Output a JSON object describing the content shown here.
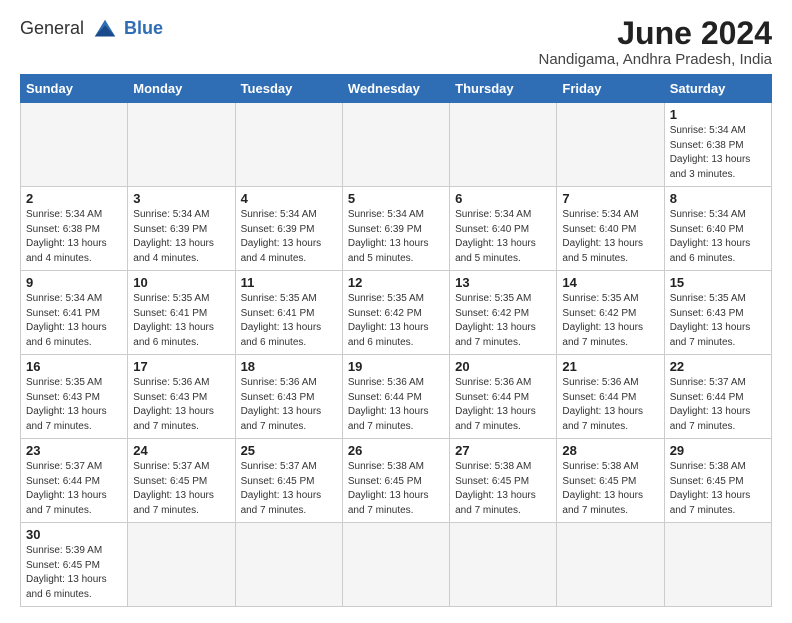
{
  "header": {
    "logo_general": "General",
    "logo_blue": "Blue",
    "title": "June 2024",
    "subtitle": "Nandigama, Andhra Pradesh, India"
  },
  "days_of_week": [
    "Sunday",
    "Monday",
    "Tuesday",
    "Wednesday",
    "Thursday",
    "Friday",
    "Saturday"
  ],
  "weeks": [
    [
      {
        "day": "",
        "info": ""
      },
      {
        "day": "",
        "info": ""
      },
      {
        "day": "",
        "info": ""
      },
      {
        "day": "",
        "info": ""
      },
      {
        "day": "",
        "info": ""
      },
      {
        "day": "",
        "info": ""
      },
      {
        "day": "1",
        "info": "Sunrise: 5:34 AM\nSunset: 6:38 PM\nDaylight: 13 hours\nand 3 minutes."
      }
    ],
    [
      {
        "day": "2",
        "info": "Sunrise: 5:34 AM\nSunset: 6:38 PM\nDaylight: 13 hours\nand 4 minutes."
      },
      {
        "day": "3",
        "info": "Sunrise: 5:34 AM\nSunset: 6:39 PM\nDaylight: 13 hours\nand 4 minutes."
      },
      {
        "day": "4",
        "info": "Sunrise: 5:34 AM\nSunset: 6:39 PM\nDaylight: 13 hours\nand 4 minutes."
      },
      {
        "day": "5",
        "info": "Sunrise: 5:34 AM\nSunset: 6:39 PM\nDaylight: 13 hours\nand 5 minutes."
      },
      {
        "day": "6",
        "info": "Sunrise: 5:34 AM\nSunset: 6:40 PM\nDaylight: 13 hours\nand 5 minutes."
      },
      {
        "day": "7",
        "info": "Sunrise: 5:34 AM\nSunset: 6:40 PM\nDaylight: 13 hours\nand 5 minutes."
      },
      {
        "day": "8",
        "info": "Sunrise: 5:34 AM\nSunset: 6:40 PM\nDaylight: 13 hours\nand 6 minutes."
      }
    ],
    [
      {
        "day": "9",
        "info": "Sunrise: 5:34 AM\nSunset: 6:41 PM\nDaylight: 13 hours\nand 6 minutes."
      },
      {
        "day": "10",
        "info": "Sunrise: 5:35 AM\nSunset: 6:41 PM\nDaylight: 13 hours\nand 6 minutes."
      },
      {
        "day": "11",
        "info": "Sunrise: 5:35 AM\nSunset: 6:41 PM\nDaylight: 13 hours\nand 6 minutes."
      },
      {
        "day": "12",
        "info": "Sunrise: 5:35 AM\nSunset: 6:42 PM\nDaylight: 13 hours\nand 6 minutes."
      },
      {
        "day": "13",
        "info": "Sunrise: 5:35 AM\nSunset: 6:42 PM\nDaylight: 13 hours\nand 7 minutes."
      },
      {
        "day": "14",
        "info": "Sunrise: 5:35 AM\nSunset: 6:42 PM\nDaylight: 13 hours\nand 7 minutes."
      },
      {
        "day": "15",
        "info": "Sunrise: 5:35 AM\nSunset: 6:43 PM\nDaylight: 13 hours\nand 7 minutes."
      }
    ],
    [
      {
        "day": "16",
        "info": "Sunrise: 5:35 AM\nSunset: 6:43 PM\nDaylight: 13 hours\nand 7 minutes."
      },
      {
        "day": "17",
        "info": "Sunrise: 5:36 AM\nSunset: 6:43 PM\nDaylight: 13 hours\nand 7 minutes."
      },
      {
        "day": "18",
        "info": "Sunrise: 5:36 AM\nSunset: 6:43 PM\nDaylight: 13 hours\nand 7 minutes."
      },
      {
        "day": "19",
        "info": "Sunrise: 5:36 AM\nSunset: 6:44 PM\nDaylight: 13 hours\nand 7 minutes."
      },
      {
        "day": "20",
        "info": "Sunrise: 5:36 AM\nSunset: 6:44 PM\nDaylight: 13 hours\nand 7 minutes."
      },
      {
        "day": "21",
        "info": "Sunrise: 5:36 AM\nSunset: 6:44 PM\nDaylight: 13 hours\nand 7 minutes."
      },
      {
        "day": "22",
        "info": "Sunrise: 5:37 AM\nSunset: 6:44 PM\nDaylight: 13 hours\nand 7 minutes."
      }
    ],
    [
      {
        "day": "23",
        "info": "Sunrise: 5:37 AM\nSunset: 6:44 PM\nDaylight: 13 hours\nand 7 minutes."
      },
      {
        "day": "24",
        "info": "Sunrise: 5:37 AM\nSunset: 6:45 PM\nDaylight: 13 hours\nand 7 minutes."
      },
      {
        "day": "25",
        "info": "Sunrise: 5:37 AM\nSunset: 6:45 PM\nDaylight: 13 hours\nand 7 minutes."
      },
      {
        "day": "26",
        "info": "Sunrise: 5:38 AM\nSunset: 6:45 PM\nDaylight: 13 hours\nand 7 minutes."
      },
      {
        "day": "27",
        "info": "Sunrise: 5:38 AM\nSunset: 6:45 PM\nDaylight: 13 hours\nand 7 minutes."
      },
      {
        "day": "28",
        "info": "Sunrise: 5:38 AM\nSunset: 6:45 PM\nDaylight: 13 hours\nand 7 minutes."
      },
      {
        "day": "29",
        "info": "Sunrise: 5:38 AM\nSunset: 6:45 PM\nDaylight: 13 hours\nand 7 minutes."
      }
    ],
    [
      {
        "day": "30",
        "info": "Sunrise: 5:39 AM\nSunset: 6:45 PM\nDaylight: 13 hours\nand 6 minutes."
      },
      {
        "day": "",
        "info": ""
      },
      {
        "day": "",
        "info": ""
      },
      {
        "day": "",
        "info": ""
      },
      {
        "day": "",
        "info": ""
      },
      {
        "day": "",
        "info": ""
      },
      {
        "day": "",
        "info": ""
      }
    ]
  ]
}
